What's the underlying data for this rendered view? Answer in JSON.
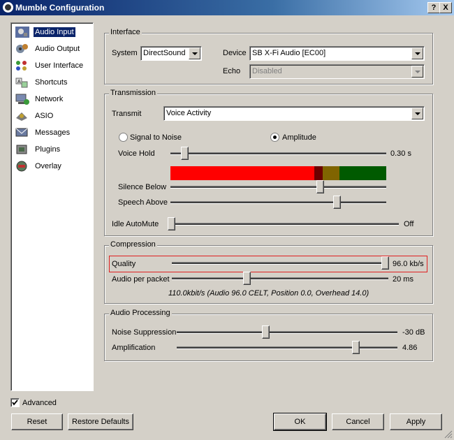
{
  "window": {
    "title": "Mumble Configuration",
    "help_button": "?",
    "close_button": "X"
  },
  "sidebar": {
    "items": [
      {
        "label": "Audio Input",
        "icon": "microphone-icon",
        "selected": true
      },
      {
        "label": "Audio Output",
        "icon": "speaker-icon"
      },
      {
        "label": "User Interface",
        "icon": "user-interface-icon"
      },
      {
        "label": "Shortcuts",
        "icon": "shortcuts-icon"
      },
      {
        "label": "Network",
        "icon": "network-icon"
      },
      {
        "label": "ASIO",
        "icon": "asio-icon"
      },
      {
        "label": "Messages",
        "icon": "messages-icon"
      },
      {
        "label": "Plugins",
        "icon": "plugins-icon"
      },
      {
        "label": "Overlay",
        "icon": "overlay-icon"
      }
    ]
  },
  "interface": {
    "title": "Interface",
    "system_label": "System",
    "system_value": "DirectSound",
    "device_label": "Device",
    "device_value": "SB X-Fi Audio [EC00]",
    "echo_label": "Echo",
    "echo_value": "Disabled"
  },
  "transmission": {
    "title": "Transmission",
    "transmit_label": "Transmit",
    "transmit_value": "Voice Activity",
    "signal_to_noise_label": "Signal to Noise",
    "amplitude_label": "Amplitude",
    "selected_mode": "Amplitude",
    "voice_hold_label": "Voice Hold",
    "voice_hold_value": "0.30 s",
    "voice_hold_level": 0.05,
    "silence_below_label": "Silence Below",
    "silence_below_level": 0.7,
    "speech_above_label": "Speech Above",
    "speech_above_level": 0.78,
    "idle_automute_label": "Idle AutoMute",
    "idle_automute_value": "Off",
    "idle_automute_level": 0.0,
    "vu_colors": {
      "red": "#ff0000",
      "dark_red": "#6b0000",
      "olive": "#806400",
      "green": "#005a00"
    }
  },
  "compression": {
    "title": "Compression",
    "quality_label": "Quality",
    "quality_value": "96.0 kb/s",
    "quality_level": 1.0,
    "audio_per_packet_label": "Audio per packet",
    "audio_per_packet_value": "20 ms",
    "audio_per_packet_level": 0.34,
    "bitrate_info": "110.0kbit/s (Audio 96.0 CELT, Position 0.0, Overhead 14.0)"
  },
  "audio_processing": {
    "title": "Audio Processing",
    "noise_suppression_label": "Noise Suppression",
    "noise_suppression_value": "-30 dB",
    "noise_suppression_level": 0.4,
    "amplification_label": "Amplification",
    "amplification_value": "4.86",
    "amplification_level": 0.82
  },
  "footer": {
    "advanced_label": "Advanced",
    "advanced_checked": true,
    "reset_label": "Reset",
    "restore_defaults_label": "Restore Defaults",
    "ok_label": "OK",
    "cancel_label": "Cancel",
    "apply_label": "Apply"
  }
}
